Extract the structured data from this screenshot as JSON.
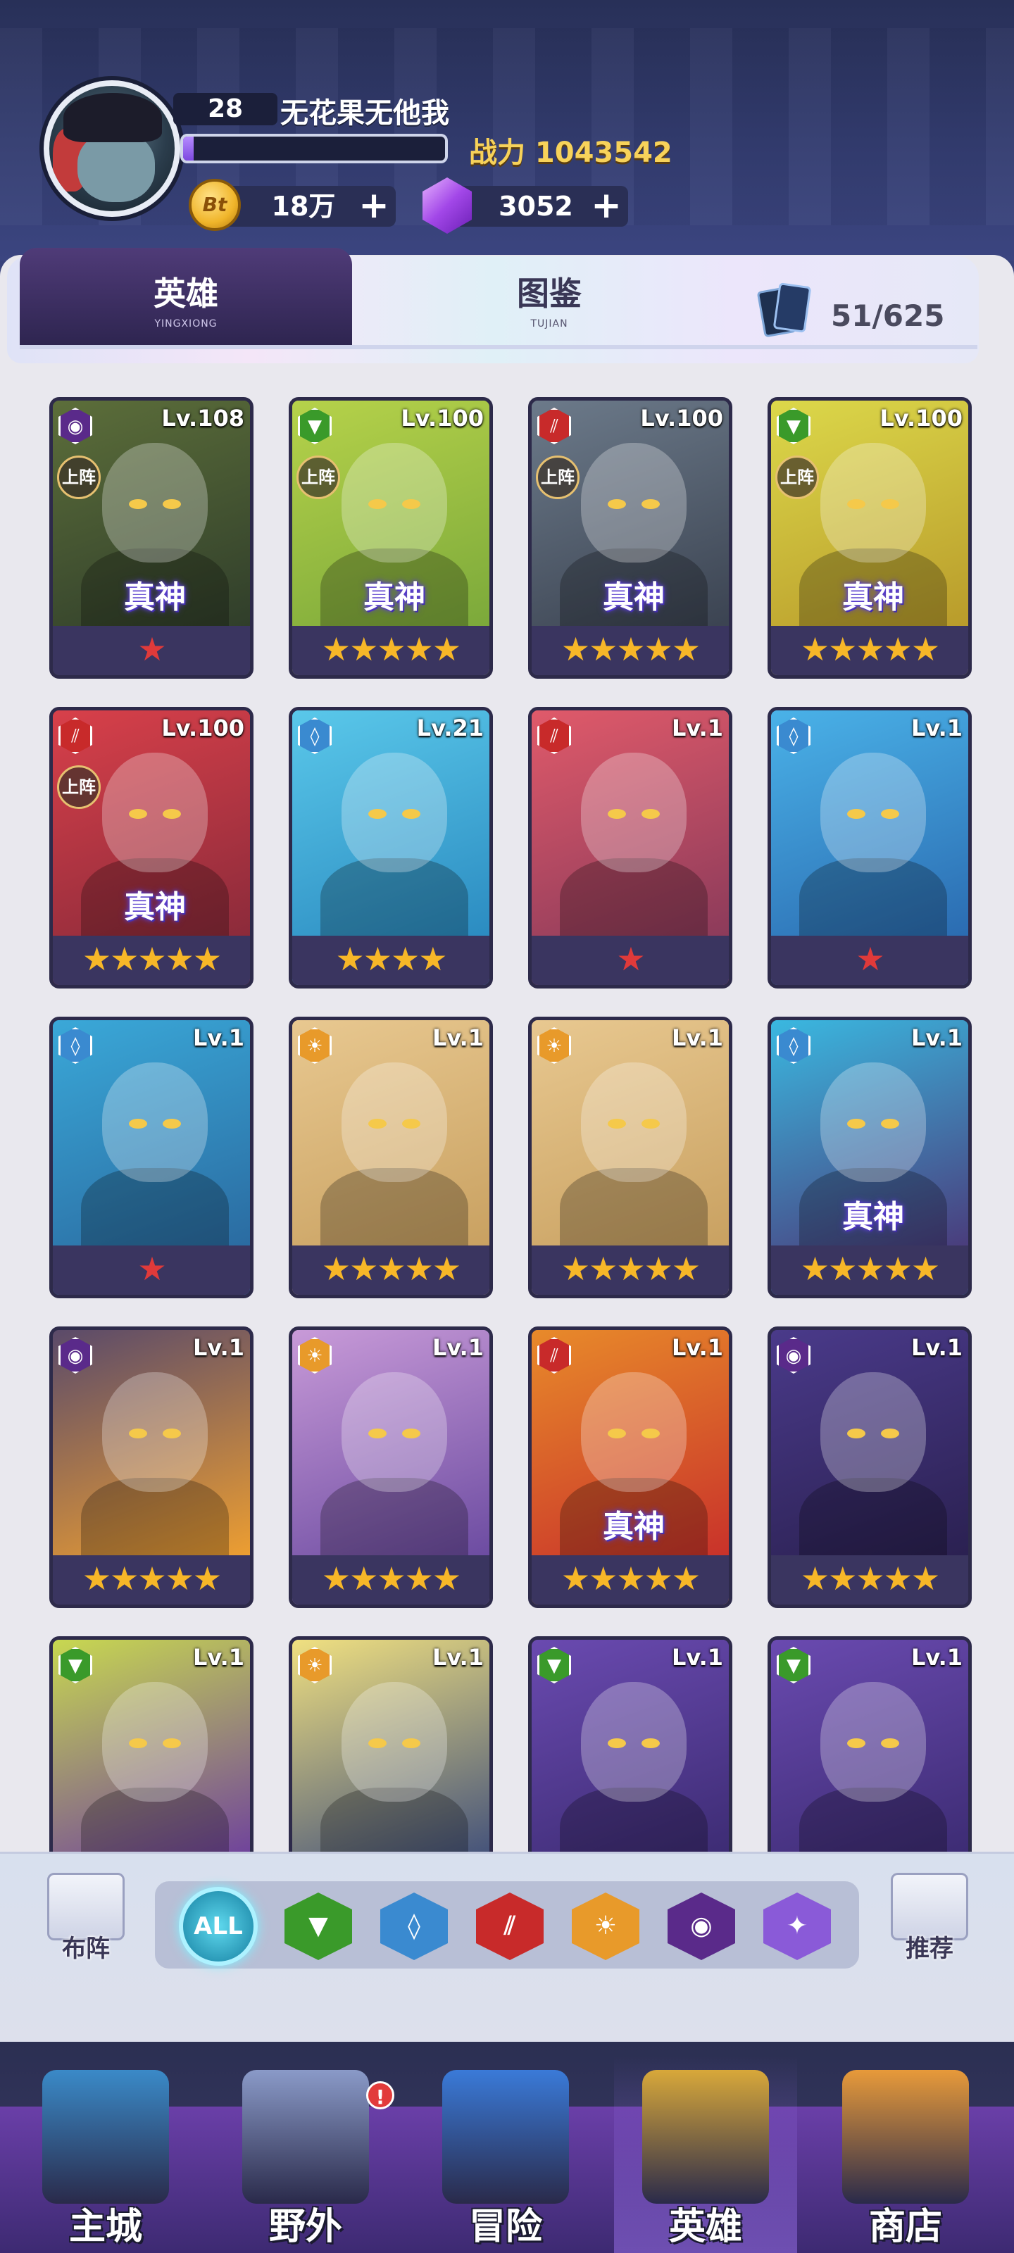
{
  "player": {
    "level": "28",
    "name": "无花果无他我",
    "power_label": "战力 1043542",
    "xp_fraction": 0.04
  },
  "currencies": {
    "gold": {
      "icon": "gold-coin-icon",
      "coin_text": "Bt",
      "value": "18万"
    },
    "gems": {
      "icon": "purple-gem-icon",
      "value": "3052"
    },
    "plus": "+"
  },
  "tabs": [
    {
      "label": "英雄",
      "sub": "YINGXIONG",
      "active": true
    },
    {
      "label": "图鉴",
      "sub": "TUJIAN",
      "active": false
    }
  ],
  "card_count": "51/625",
  "labels": {
    "deployed": "上阵",
    "true_god": "真神"
  },
  "heroes": [
    {
      "level": "Lv.108",
      "element": "dark",
      "deployed": true,
      "true_god": true,
      "stars": 1,
      "star_color": "red",
      "bg": [
        "#5c6e3a",
        "#2f3d2a"
      ]
    },
    {
      "level": "Lv.100",
      "element": "nature",
      "deployed": true,
      "true_god": true,
      "stars": 5,
      "star_color": "gold",
      "bg": [
        "#b6d24a",
        "#7aa83a"
      ]
    },
    {
      "level": "Lv.100",
      "element": "fire",
      "deployed": true,
      "true_god": true,
      "stars": 5,
      "star_color": "gold",
      "bg": [
        "#6c7a8a",
        "#3a4250"
      ]
    },
    {
      "level": "Lv.100",
      "element": "nature",
      "deployed": true,
      "true_god": true,
      "stars": 5,
      "star_color": "gold",
      "bg": [
        "#dcd84a",
        "#b89a2a"
      ]
    },
    {
      "level": "Lv.100",
      "element": "fire",
      "deployed": true,
      "true_god": true,
      "stars": 5,
      "star_color": "gold",
      "bg": [
        "#d8404a",
        "#8a2a3a"
      ]
    },
    {
      "level": "Lv.21",
      "element": "water",
      "deployed": false,
      "true_god": false,
      "stars": 4,
      "star_color": "gold",
      "bg": [
        "#5ac8ea",
        "#2a8ac0"
      ]
    },
    {
      "level": "Lv.1",
      "element": "fire",
      "deployed": false,
      "true_god": false,
      "stars": 1,
      "star_color": "red",
      "bg": [
        "#e05a6a",
        "#8a3a5a"
      ]
    },
    {
      "level": "Lv.1",
      "element": "water",
      "deployed": false,
      "true_god": false,
      "stars": 1,
      "star_color": "red",
      "bg": [
        "#4ab2e8",
        "#2a6ab0"
      ]
    },
    {
      "level": "Lv.1",
      "element": "water",
      "deployed": false,
      "true_god": false,
      "stars": 1,
      "star_color": "red",
      "bg": [
        "#3aa8d8",
        "#2a6aa0"
      ]
    },
    {
      "level": "Lv.1",
      "element": "light",
      "deployed": false,
      "true_god": false,
      "stars": 5,
      "star_color": "gold",
      "bg": [
        "#e8c890",
        "#c8a060"
      ]
    },
    {
      "level": "Lv.1",
      "element": "light",
      "deployed": false,
      "true_god": false,
      "stars": 5,
      "star_color": "gold",
      "bg": [
        "#e8c890",
        "#c8a060"
      ]
    },
    {
      "level": "Lv.1",
      "element": "water",
      "deployed": false,
      "true_god": true,
      "stars": 5,
      "star_color": "gold",
      "bg": [
        "#3ab8e0",
        "#4a3a7a"
      ]
    },
    {
      "level": "Lv.1",
      "element": "dark",
      "deployed": false,
      "true_god": false,
      "stars": 5,
      "star_color": "gold",
      "bg": [
        "#5a4a6a",
        "#f0a030"
      ]
    },
    {
      "level": "Lv.1",
      "element": "light",
      "deployed": false,
      "true_god": false,
      "stars": 5,
      "star_color": "gold",
      "bg": [
        "#c89ad8",
        "#6a4aa0"
      ]
    },
    {
      "level": "Lv.1",
      "element": "fire",
      "deployed": false,
      "true_god": true,
      "stars": 5,
      "star_color": "gold",
      "bg": [
        "#e88a2a",
        "#c8302a"
      ]
    },
    {
      "level": "Lv.1",
      "element": "dark",
      "deployed": false,
      "true_god": false,
      "stars": 5,
      "star_color": "gold",
      "bg": [
        "#4a3a8a",
        "#2a2050"
      ]
    },
    {
      "level": "Lv.1",
      "element": "nature",
      "deployed": false,
      "true_god": false,
      "stars": 0,
      "star_color": "gold",
      "bg": [
        "#c8d850",
        "#6a3aa0"
      ]
    },
    {
      "level": "Lv.1",
      "element": "light",
      "deployed": false,
      "true_god": false,
      "stars": 0,
      "star_color": "gold",
      "bg": [
        "#f0e080",
        "#3a4a7a"
      ]
    },
    {
      "level": "Lv.1",
      "element": "nature",
      "deployed": false,
      "true_god": false,
      "stars": 0,
      "star_color": "gold",
      "bg": [
        "#6a4ab0",
        "#3a2a70"
      ]
    },
    {
      "level": "Lv.1",
      "element": "nature",
      "deployed": false,
      "true_god": false,
      "stars": 0,
      "star_color": "gold",
      "bg": [
        "#6a4ab0",
        "#3a2a70"
      ]
    }
  ],
  "element_colors": {
    "dark": "#5a2a8a",
    "nature": "#3a9a2a",
    "fire": "#c82a2a",
    "water": "#3a8ad0",
    "light": "#e89a2a",
    "arcane": "#8a5ad8"
  },
  "element_glyphs": {
    "dark": "◉",
    "nature": "▼",
    "fire": "⫽",
    "water": "◊",
    "light": "☀",
    "arcane": "✦"
  },
  "filter": {
    "formation_label": "布阵",
    "recommend_label": "推荐",
    "all_label": "ALL",
    "elements": [
      "nature",
      "water",
      "fire",
      "light",
      "dark",
      "arcane"
    ]
  },
  "nav": [
    {
      "label": "主城",
      "icon": "main-city-icon",
      "color": "#3a8ac8",
      "active": false
    },
    {
      "label": "野外",
      "icon": "wild-icon",
      "color": "#8a9ac8",
      "active": false,
      "badge": "!"
    },
    {
      "label": "冒险",
      "icon": "adventure-icon",
      "color": "#3a7ad8",
      "active": false
    },
    {
      "label": "英雄",
      "icon": "hero-icon",
      "color": "#d8a83a",
      "active": true
    },
    {
      "label": "商店",
      "icon": "shop-icon",
      "color": "#e89a3a",
      "active": false
    }
  ]
}
